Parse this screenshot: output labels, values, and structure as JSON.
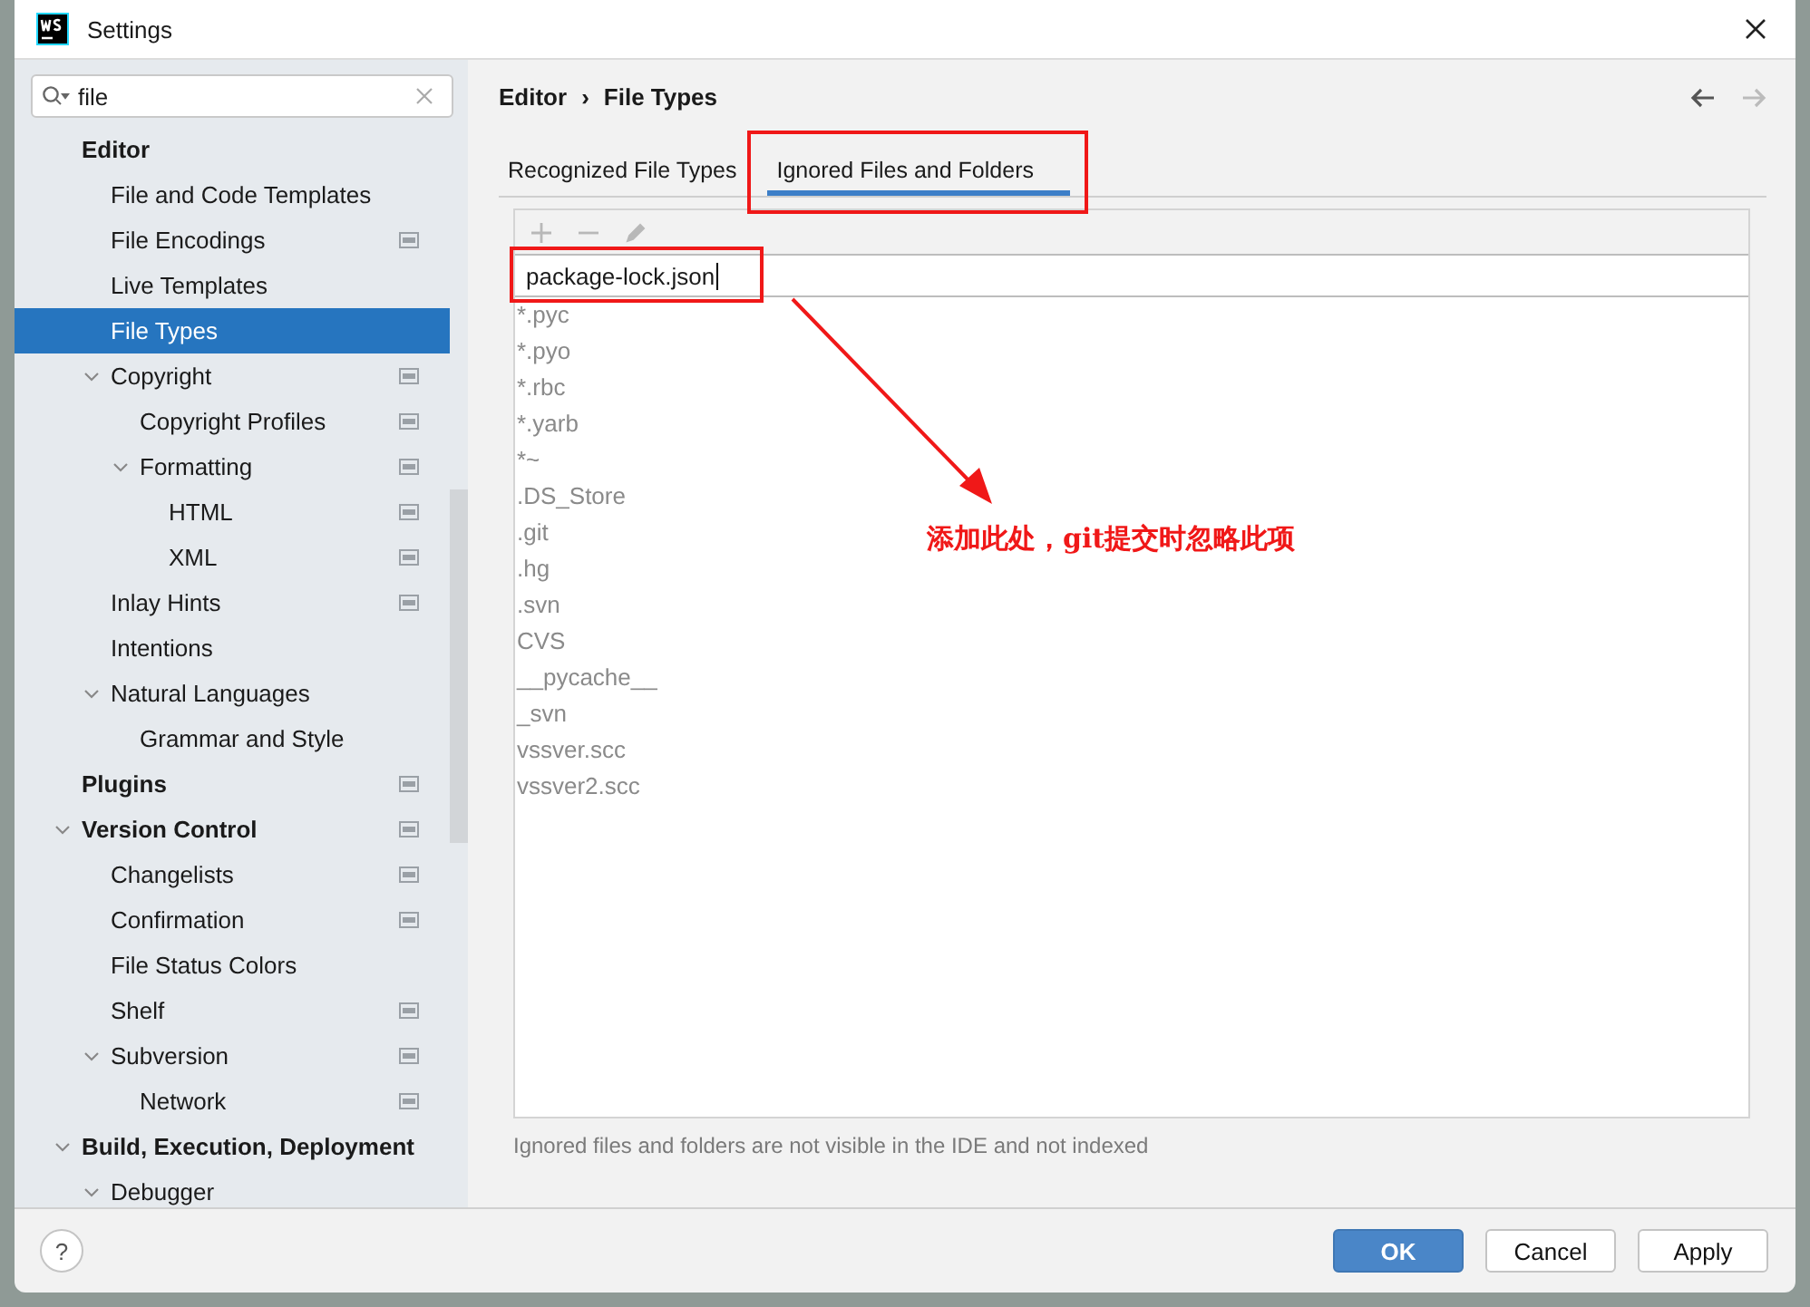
{
  "window": {
    "title": "Settings"
  },
  "search": {
    "value": "file"
  },
  "tree": [
    {
      "label": "Editor",
      "kind": "section",
      "selected": false,
      "scoped": false,
      "children": [
        {
          "label": "File and Code Templates",
          "kind": "page",
          "selected": false,
          "scoped": false
        },
        {
          "label": "File Encodings",
          "kind": "page",
          "selected": false,
          "scoped": true
        },
        {
          "label": "Live Templates",
          "kind": "page",
          "selected": false,
          "scoped": false
        },
        {
          "label": "File Types",
          "kind": "page",
          "selected": true,
          "scoped": false
        },
        {
          "label": "Copyright",
          "kind": "page",
          "selected": false,
          "scoped": true,
          "expanded": true,
          "children": [
            {
              "label": "Copyright Profiles",
              "kind": "page",
              "selected": false,
              "scoped": true
            },
            {
              "label": "Formatting",
              "kind": "page",
              "selected": false,
              "scoped": true,
              "expanded": true,
              "children": [
                {
                  "label": "HTML",
                  "kind": "page",
                  "selected": false,
                  "scoped": true
                },
                {
                  "label": "XML",
                  "kind": "page",
                  "selected": false,
                  "scoped": true
                }
              ]
            }
          ]
        },
        {
          "label": "Inlay Hints",
          "kind": "page",
          "selected": false,
          "scoped": true
        },
        {
          "label": "Intentions",
          "kind": "page",
          "selected": false,
          "scoped": false
        },
        {
          "label": "Natural Languages",
          "kind": "page",
          "selected": false,
          "scoped": false,
          "expanded": true,
          "children": [
            {
              "label": "Grammar and Style",
              "kind": "page",
              "selected": false,
              "scoped": false
            }
          ]
        }
      ]
    },
    {
      "label": "Plugins",
      "kind": "section",
      "selected": false,
      "scoped": true
    },
    {
      "label": "Version Control",
      "kind": "section",
      "selected": false,
      "scoped": true,
      "expanded": true,
      "children": [
        {
          "label": "Changelists",
          "kind": "page",
          "selected": false,
          "scoped": true
        },
        {
          "label": "Confirmation",
          "kind": "page",
          "selected": false,
          "scoped": true
        },
        {
          "label": "File Status Colors",
          "kind": "page",
          "selected": false,
          "scoped": false
        },
        {
          "label": "Shelf",
          "kind": "page",
          "selected": false,
          "scoped": true
        },
        {
          "label": "Subversion",
          "kind": "page",
          "selected": false,
          "scoped": true,
          "expanded": true,
          "children": [
            {
              "label": "Network",
              "kind": "page",
              "selected": false,
              "scoped": true
            }
          ]
        }
      ]
    },
    {
      "label": "Build, Execution, Deployment",
      "kind": "section",
      "selected": false,
      "scoped": false,
      "expanded": true,
      "children": [
        {
          "label": "Debugger",
          "kind": "page",
          "selected": false,
          "scoped": false,
          "expanded": true
        }
      ]
    }
  ],
  "breadcrumb": {
    "parent": "Editor",
    "separator": "›",
    "current": "File Types"
  },
  "navigation": [
    {
      "kind": "back",
      "disabled": false
    },
    {
      "kind": "forward",
      "disabled": true
    }
  ],
  "tabs": [
    {
      "label": "Recognized File Types",
      "selected": false
    },
    {
      "label": "Ignored Files and Folders",
      "selected": true
    }
  ],
  "toolbar": [
    {
      "kind": "add",
      "disabled": true
    },
    {
      "kind": "remove",
      "disabled": true
    },
    {
      "kind": "edit",
      "disabled": true
    }
  ],
  "new_entry": {
    "value": "package-lock.json"
  },
  "patterns": [
    "*.pyc",
    "*.pyo",
    "*.rbc",
    "*.yarb",
    "*~",
    ".DS_Store",
    ".git",
    ".hg",
    ".svn",
    "CVS",
    "__pycache__",
    "_svn",
    "vssver.scc",
    "vssver2.scc"
  ],
  "hint": "Ignored files and folders are not visible in the IDE and not indexed",
  "help": {
    "label": "?"
  },
  "buttons": [
    {
      "label": "OK",
      "kind": "primary"
    },
    {
      "label": "Cancel",
      "kind": "normal"
    },
    {
      "label": "Apply",
      "kind": "normal"
    }
  ],
  "annotation": {
    "note": "添加此处，git提交时忽略此项"
  }
}
